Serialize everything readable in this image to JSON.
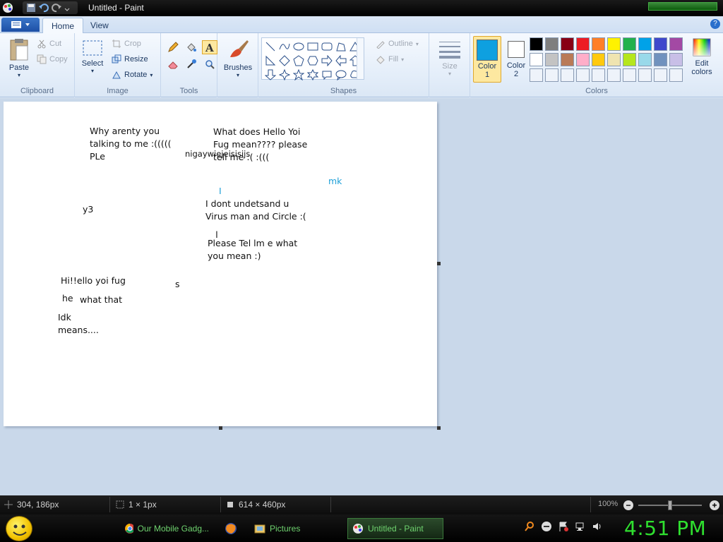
{
  "window": {
    "title": "Untitled - Paint"
  },
  "tabs": {
    "home": "Home",
    "view": "View"
  },
  "ribbon": {
    "clipboard": {
      "label": "Clipboard",
      "paste": "Paste",
      "cut": "Cut",
      "copy": "Copy"
    },
    "image": {
      "label": "Image",
      "select": "Select",
      "crop": "Crop",
      "resize": "Resize",
      "rotate": "Rotate"
    },
    "tools": {
      "label": "Tools"
    },
    "brushes": {
      "label": "Brushes"
    },
    "shapes": {
      "label": "Shapes",
      "outline": "Outline",
      "fill": "Fill"
    },
    "size": {
      "label": "Size"
    },
    "colors": {
      "label": "Colors",
      "color1": "Color\n1",
      "color2": "Color\n2",
      "edit": "Edit\ncolors",
      "color1_value": "#0ea0e0",
      "color2_value": "#ffffff",
      "row1": [
        "#000000",
        "#7f7f7f",
        "#880015",
        "#ed1c24",
        "#ff7f27",
        "#fff200",
        "#22b14c",
        "#00a2e8",
        "#3f48cc",
        "#a349a4"
      ],
      "row2": [
        "#ffffff",
        "#c3c3c3",
        "#b97a57",
        "#ffaec9",
        "#ffc90e",
        "#efe4b0",
        "#b5e61d",
        "#99d9ea",
        "#7092be",
        "#c8bfe7"
      ],
      "row3": [
        "#eef3fa",
        "#eef3fa",
        "#eef3fa",
        "#eef3fa",
        "#eef3fa",
        "#eef3fa",
        "#eef3fa",
        "#eef3fa",
        "#eef3fa",
        "#eef3fa"
      ]
    }
  },
  "canvas_text": {
    "t1": "Why arenty you\ntalking to me :(((((\nPLe",
    "t2": "What does Hello Yoi\nFug mean???? please\ntell me :( :(((",
    "t3": "nigaywiejeisisijs",
    "t4": "mk",
    "t5": "I",
    "t6": "y3",
    "t7": "I dont undetsand u\nVirus man and Circle :(",
    "t8": "Please Tel lm e what\nyou mean :)",
    "t9": "Hi!!ello yoi fug",
    "t10": "s",
    "t11": "he",
    "t12": "what that",
    "t13": "Idk\nmeans...."
  },
  "status": {
    "cursor_pos": "304, 186px",
    "selection_size": "1 × 1px",
    "canvas_size": "614 × 460px",
    "zoom": "100%"
  },
  "taskbar": {
    "tasks": [
      "Our Mobile Gadg...",
      "Pictures",
      "Untitled - Paint"
    ],
    "clock": "4:51 PM"
  }
}
